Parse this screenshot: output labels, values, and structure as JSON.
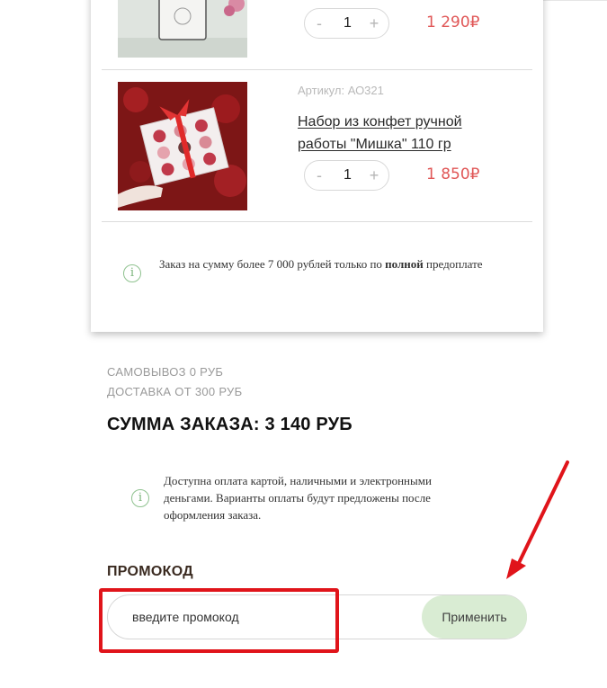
{
  "cart": {
    "items": [
      {
        "quantity": "1",
        "price": "1 290₽",
        "minus_label": "-",
        "plus_label": "+",
        "image_icon": "candle-product-image"
      },
      {
        "sku": "Артикул: АО321",
        "name": "Набор из конфет ручной работы \"Мишка\" 110 гр",
        "quantity": "1",
        "price": "1 850₽",
        "minus_label": "-",
        "plus_label": "+",
        "image_icon": "candy-box-product-image"
      }
    ],
    "notice": {
      "icon": "info-icon",
      "text_before": "Заказ на сумму более 7 000 рублей только по ",
      "text_bold": "полной",
      "text_after": " предоплате"
    }
  },
  "summary": {
    "pickup": "САМОВЫВОЗ 0 РУБ",
    "delivery": "ДОСТАВКА ОТ 300 РУБ",
    "total": "СУММА ЗАКАЗА: 3 140 РУБ"
  },
  "payment_notice": {
    "icon": "info-icon",
    "text": "Доступна оплата картой, наличными и электронными деньгами. Варианты оплаты будут предложены после оформления заказа."
  },
  "promo": {
    "title": "ПРОМОКОД",
    "placeholder": "введите промокод",
    "button_label": "Применить"
  },
  "colors": {
    "price": "#e05757",
    "apply_button": "#d9ecd3",
    "info_icon": "#8fc28f",
    "annotation": "#e0141a"
  }
}
